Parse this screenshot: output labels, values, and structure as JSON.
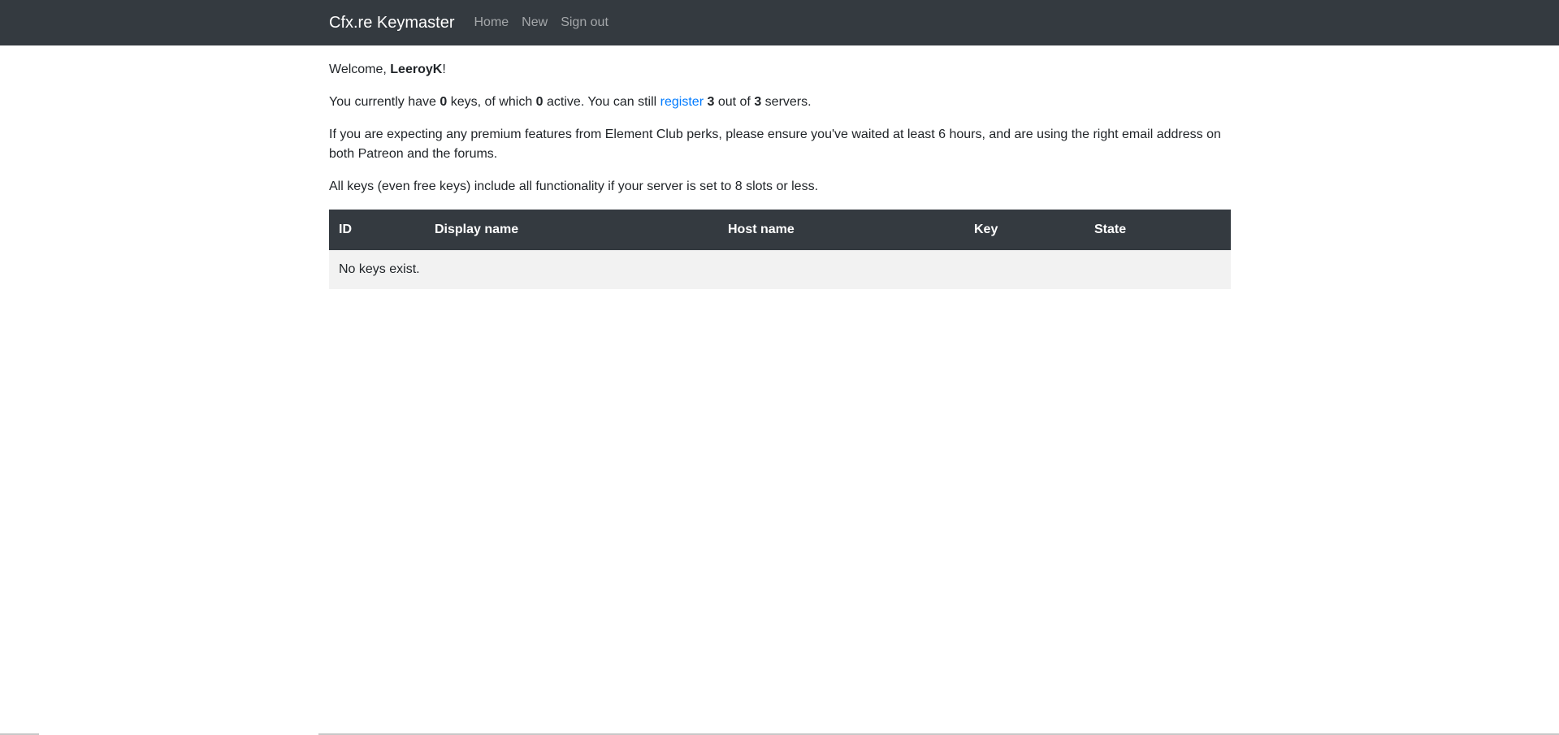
{
  "nav": {
    "brand": "Cfx.re Keymaster",
    "links": [
      "Home",
      "New",
      "Sign out"
    ]
  },
  "welcome": {
    "prefix": "Welcome, ",
    "username": "LeeroyK",
    "suffix": "!"
  },
  "keys_summary": {
    "t1": "You currently have ",
    "keys_count": "0",
    "t2": " keys, of which ",
    "active_count": "0",
    "t3": " active. You can still ",
    "register_link": "register",
    "t4": " ",
    "remaining": "3",
    "t5": " out of ",
    "total": "3",
    "t6": " servers."
  },
  "premium_notice": "If you are expecting any premium features from Element Club perks, please ensure you've waited at least 6 hours, and are using the right email address on both Patreon and the forums.",
  "free_keys_notice": "All keys (even free keys) include all functionality if your server is set to 8 slots or less.",
  "table": {
    "headers": [
      "ID",
      "Display name",
      "Host name",
      "Key",
      "State"
    ],
    "empty_message": "No keys exist."
  },
  "colors": {
    "navbar_bg": "#343a40",
    "link": "#007bff",
    "row_bg": "#f2f2f2"
  }
}
